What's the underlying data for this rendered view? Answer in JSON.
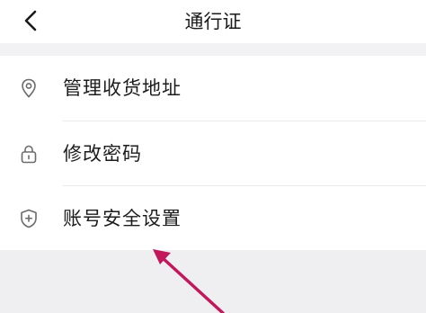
{
  "header": {
    "title": "通行证",
    "back_icon": "chevron-left-icon"
  },
  "list": {
    "items": [
      {
        "label": "管理收货地址",
        "icon": "location-pin-icon"
      },
      {
        "label": "修改密码",
        "icon": "lock-icon"
      },
      {
        "label": "账号安全设置",
        "icon": "shield-plus-icon"
      }
    ]
  },
  "annotation": {
    "arrow_color": "#c2185b"
  },
  "colors": {
    "background": "#f2f2f4",
    "surface": "#ffffff",
    "icon": "#6b6b6b"
  }
}
